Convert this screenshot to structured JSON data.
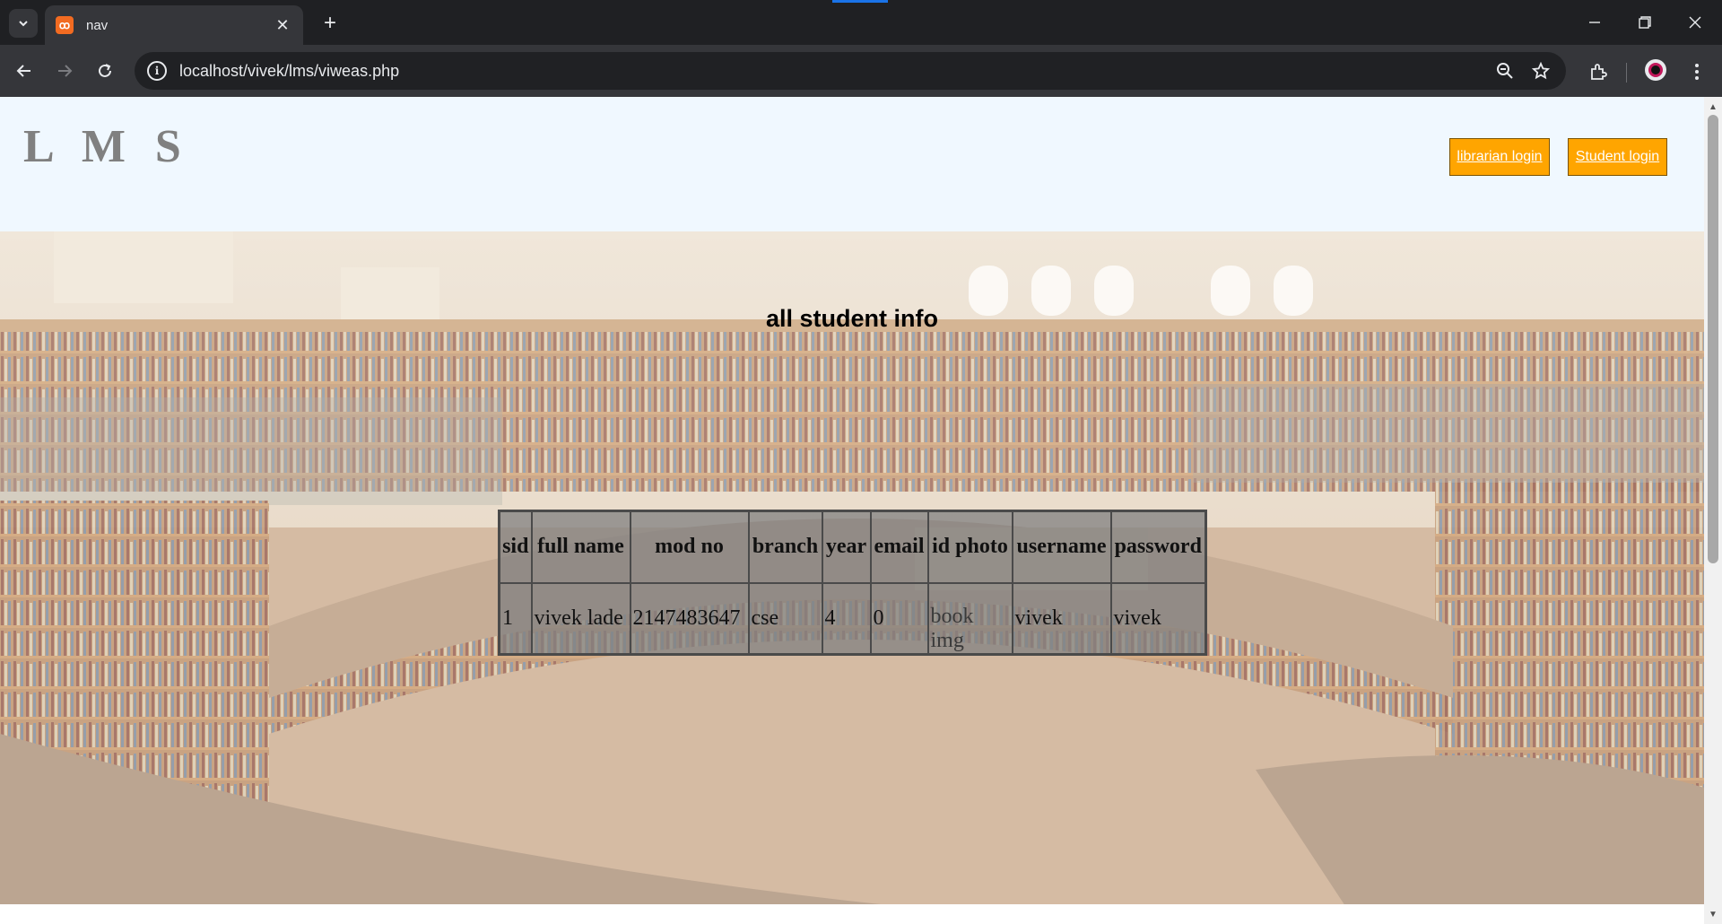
{
  "browser": {
    "tab_title": "nav",
    "url": "localhost/vivek/lms/viweas.php",
    "icons": [
      "tab-search-icon",
      "close-icon",
      "plus-icon",
      "minimize-icon",
      "restore-icon",
      "back-icon",
      "forward-icon",
      "reload-icon",
      "site-info-icon",
      "zoom-icon",
      "star-icon",
      "extensions-icon",
      "profile-icon",
      "menu-icon"
    ]
  },
  "site": {
    "logo": "L M S",
    "nav": {
      "librarian_login": "librarian login",
      "student_login": "Student login"
    },
    "accent_color": "#ffa500",
    "header_bg": "#f0f8ff"
  },
  "main": {
    "heading": "all student info",
    "table": {
      "headers": [
        "sid",
        "full name",
        "mod no",
        "branch",
        "year",
        "email",
        "id photo",
        "username",
        "password"
      ],
      "rows": [
        {
          "sid": "1",
          "full_name": "vivek lade",
          "mod_no": "2147483647",
          "branch": "cse",
          "year": "4",
          "email": "0",
          "id_photo_alt": "book img",
          "username": "vivek",
          "password": "vivek"
        }
      ]
    }
  }
}
